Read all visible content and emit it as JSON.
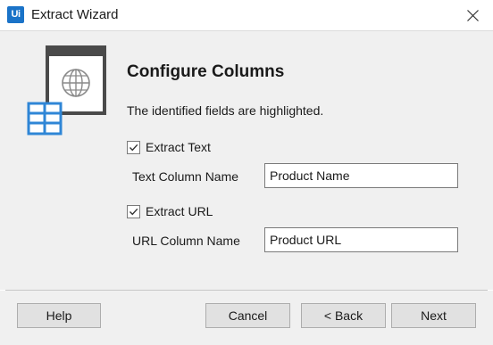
{
  "window": {
    "logo_text": "Ui",
    "title": "Extract Wizard",
    "close_icon": "close-icon"
  },
  "header": {
    "title": "Configure Columns",
    "description": "The identified fields are highlighted.",
    "icon": "table-web-icon"
  },
  "text_section": {
    "checkbox_label": "Extract Text",
    "checked": true,
    "field_label": "Text Column Name",
    "field_value": "Product Name"
  },
  "url_section": {
    "checkbox_label": "Extract URL",
    "checked": true,
    "field_label": "URL Column Name",
    "field_value": "Product URL"
  },
  "footer": {
    "help_label": "Help",
    "cancel_label": "Cancel",
    "back_label": "< Back",
    "next_label": "Next"
  },
  "colors": {
    "logo_blue": "#1a73c8",
    "icon_blue": "#2f86d6",
    "panel_bg": "#f0f0f0"
  }
}
